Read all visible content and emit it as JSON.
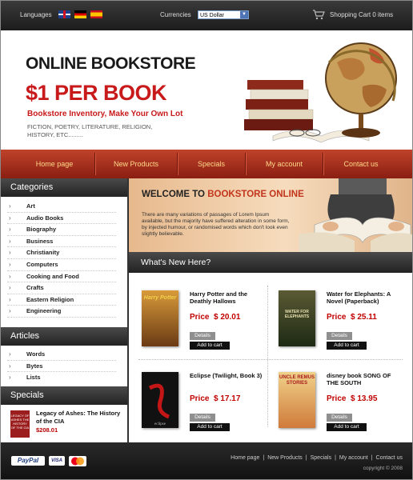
{
  "topbar": {
    "languages_label": "Languages",
    "currencies_label": "Currencies",
    "currency_selected": "US Dollar",
    "cart_label": "Shopping Cart 0 items",
    "flags": [
      "uk-flag-icon",
      "germany-flag-icon",
      "spain-flag-icon"
    ]
  },
  "header": {
    "store_title": "ONLINE BOOKSTORE",
    "promo": "$1 PER BOOK",
    "promo_sub": "Bookstore Inventory, Make Your Own Lot",
    "genres": "FICTION, POETRY, LITERATURE, RELIGION, HISTORY, ETC.........",
    "art_icon": "globe-and-books-image"
  },
  "nav": {
    "items": [
      "Home page",
      "New Products",
      "Specials",
      "My account",
      "Contact us"
    ]
  },
  "sidebar": {
    "categories_title": "Categories",
    "categories": [
      "Art",
      "Audio Books",
      "Biography",
      "Business",
      "Christianity",
      "Computers",
      "Cooking and Food",
      "Crafts",
      "Eastern Religion",
      "Engineering"
    ],
    "articles_title": "Articles",
    "articles": [
      "Words",
      "Bytes",
      "Lists"
    ],
    "specials_title": "Specials",
    "special": {
      "title": "Legacy of Ashes: The History of the CIA",
      "price": "$208.01",
      "cover_text": "LEGACY OF ASHES THE HISTORY OF THE CIA"
    }
  },
  "welcome": {
    "title_prefix": "WELCOME TO ",
    "title_highlight": "BOOKSTORE ONLINE",
    "text": "There are many variations of passages of Lorem Ipsum available, but the majority have suffered alteration in some form, by injected humour, or randomised words which don't look even slightly believable."
  },
  "whats_new": {
    "title": "What's New Here?",
    "price_label": "Price",
    "details_label": "Details",
    "cart_label": "Add to cart",
    "products": [
      {
        "title": "Harry Potter and the Deathly Hallows",
        "price": "$ 20.01",
        "cover_color": "#7a4a1e",
        "cover_text": "Harry Potter"
      },
      {
        "title": "Water for Elephants: A Novel (Paperback)",
        "price": "$ 25.11",
        "cover_color": "#3b3a22",
        "cover_text": "WATER FOR ELEPHANTS"
      },
      {
        "title": "Eclipse (Twilight, Book 3)",
        "price": "$ 17.17",
        "cover_color": "#111111",
        "cover_text": "eclipse"
      },
      {
        "title": "disney book SONG OF THE SOUTH",
        "price": "$ 13.95",
        "cover_color": "#e6c27a",
        "cover_text": "UNCLE REMUS STORIES"
      }
    ]
  },
  "footer": {
    "links": [
      "Home page",
      "New Products",
      "Specials",
      "My account",
      "Contact us"
    ],
    "copyright": "copyright © 2008",
    "payment_paypal": "PayPal",
    "payment_visa": "VISA",
    "payment_mastercard": "mastercard-icon"
  }
}
